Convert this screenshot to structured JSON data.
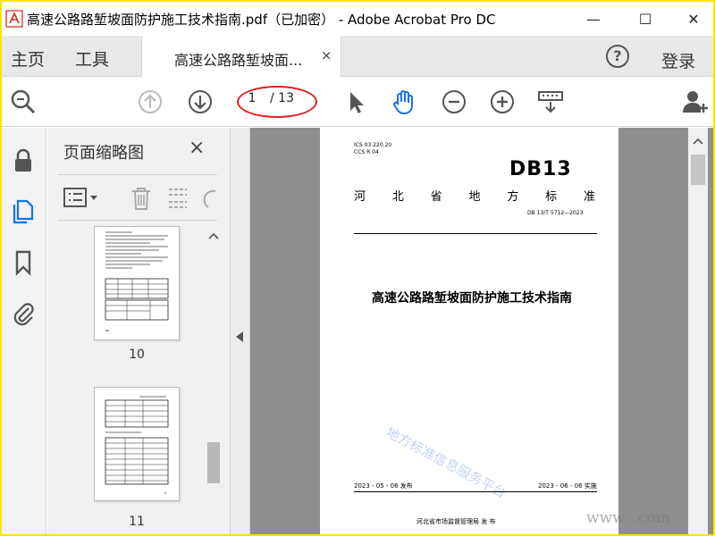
{
  "window": {
    "title": "高速公路路堑坡面防护施工技术指南.pdf（已加密） - Adobe Acrobat Pro DC",
    "minimize": "—",
    "maximize": "☐",
    "close": "✕"
  },
  "tabs": {
    "home": "主页",
    "tools": "工具",
    "document": "高速公路路堑坡面...",
    "document_close": "×",
    "help": "?",
    "login": "登录"
  },
  "toolbar": {
    "current_page": "1",
    "page_total": "/ 13"
  },
  "thumbnails": {
    "title": "页面缩略图",
    "close": "×",
    "pages": [
      "10",
      "11"
    ]
  },
  "document_page": {
    "ics_line1": "ICS  03.220.20",
    "ics_line2": "CCS  R  04",
    "logo": "DB13",
    "category_chars": [
      "河",
      "北",
      "省",
      "地",
      "方",
      "标",
      "准"
    ],
    "standard_number": "DB 13/T  5712—2023",
    "title": "高速公路路堑坡面防护施工技术指南",
    "watermark": "地方标准信息服务平台",
    "publish_date": "2023 - 05 - 06 发布",
    "implement_date": "2023 - 06 - 06 实施",
    "issuer": "河北省市场监督管理局      发  布"
  },
  "corner_watermark": "www.      .com",
  "colors": {
    "accent_blue": "#1473e6",
    "highlight_red": "#e02020",
    "frame_yellow": "#f7e600"
  }
}
